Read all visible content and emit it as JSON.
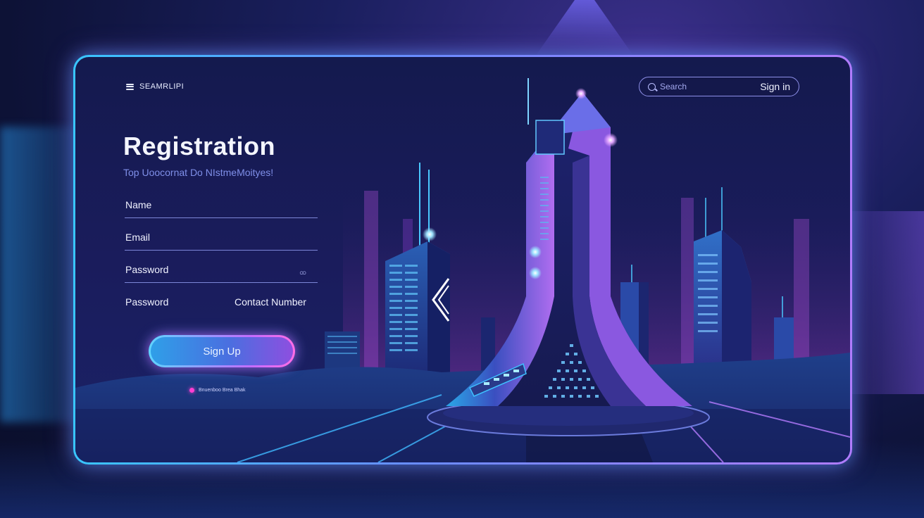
{
  "header": {
    "brand": "SEAMRLIPI",
    "search_placeholder": "Search",
    "signin_label": "Sign in"
  },
  "form": {
    "title": "Registration",
    "subtitle": "Top Uoocornat Do NIstmeMoityes!",
    "fields": {
      "name_label": "Name",
      "email_label": "Email",
      "password_label": "Password",
      "password_toggle": "ထ",
      "password2_label": "Password",
      "contact_label": "Contact Number"
    },
    "signup_label": "Sign Up",
    "footnote": "Bnuenboo Brea Bhak"
  },
  "colors": {
    "accent_cyan": "#39c6ff",
    "accent_purple": "#b07cff",
    "accent_magenta": "#ff3fd2",
    "panel_bg": "#161b56"
  }
}
